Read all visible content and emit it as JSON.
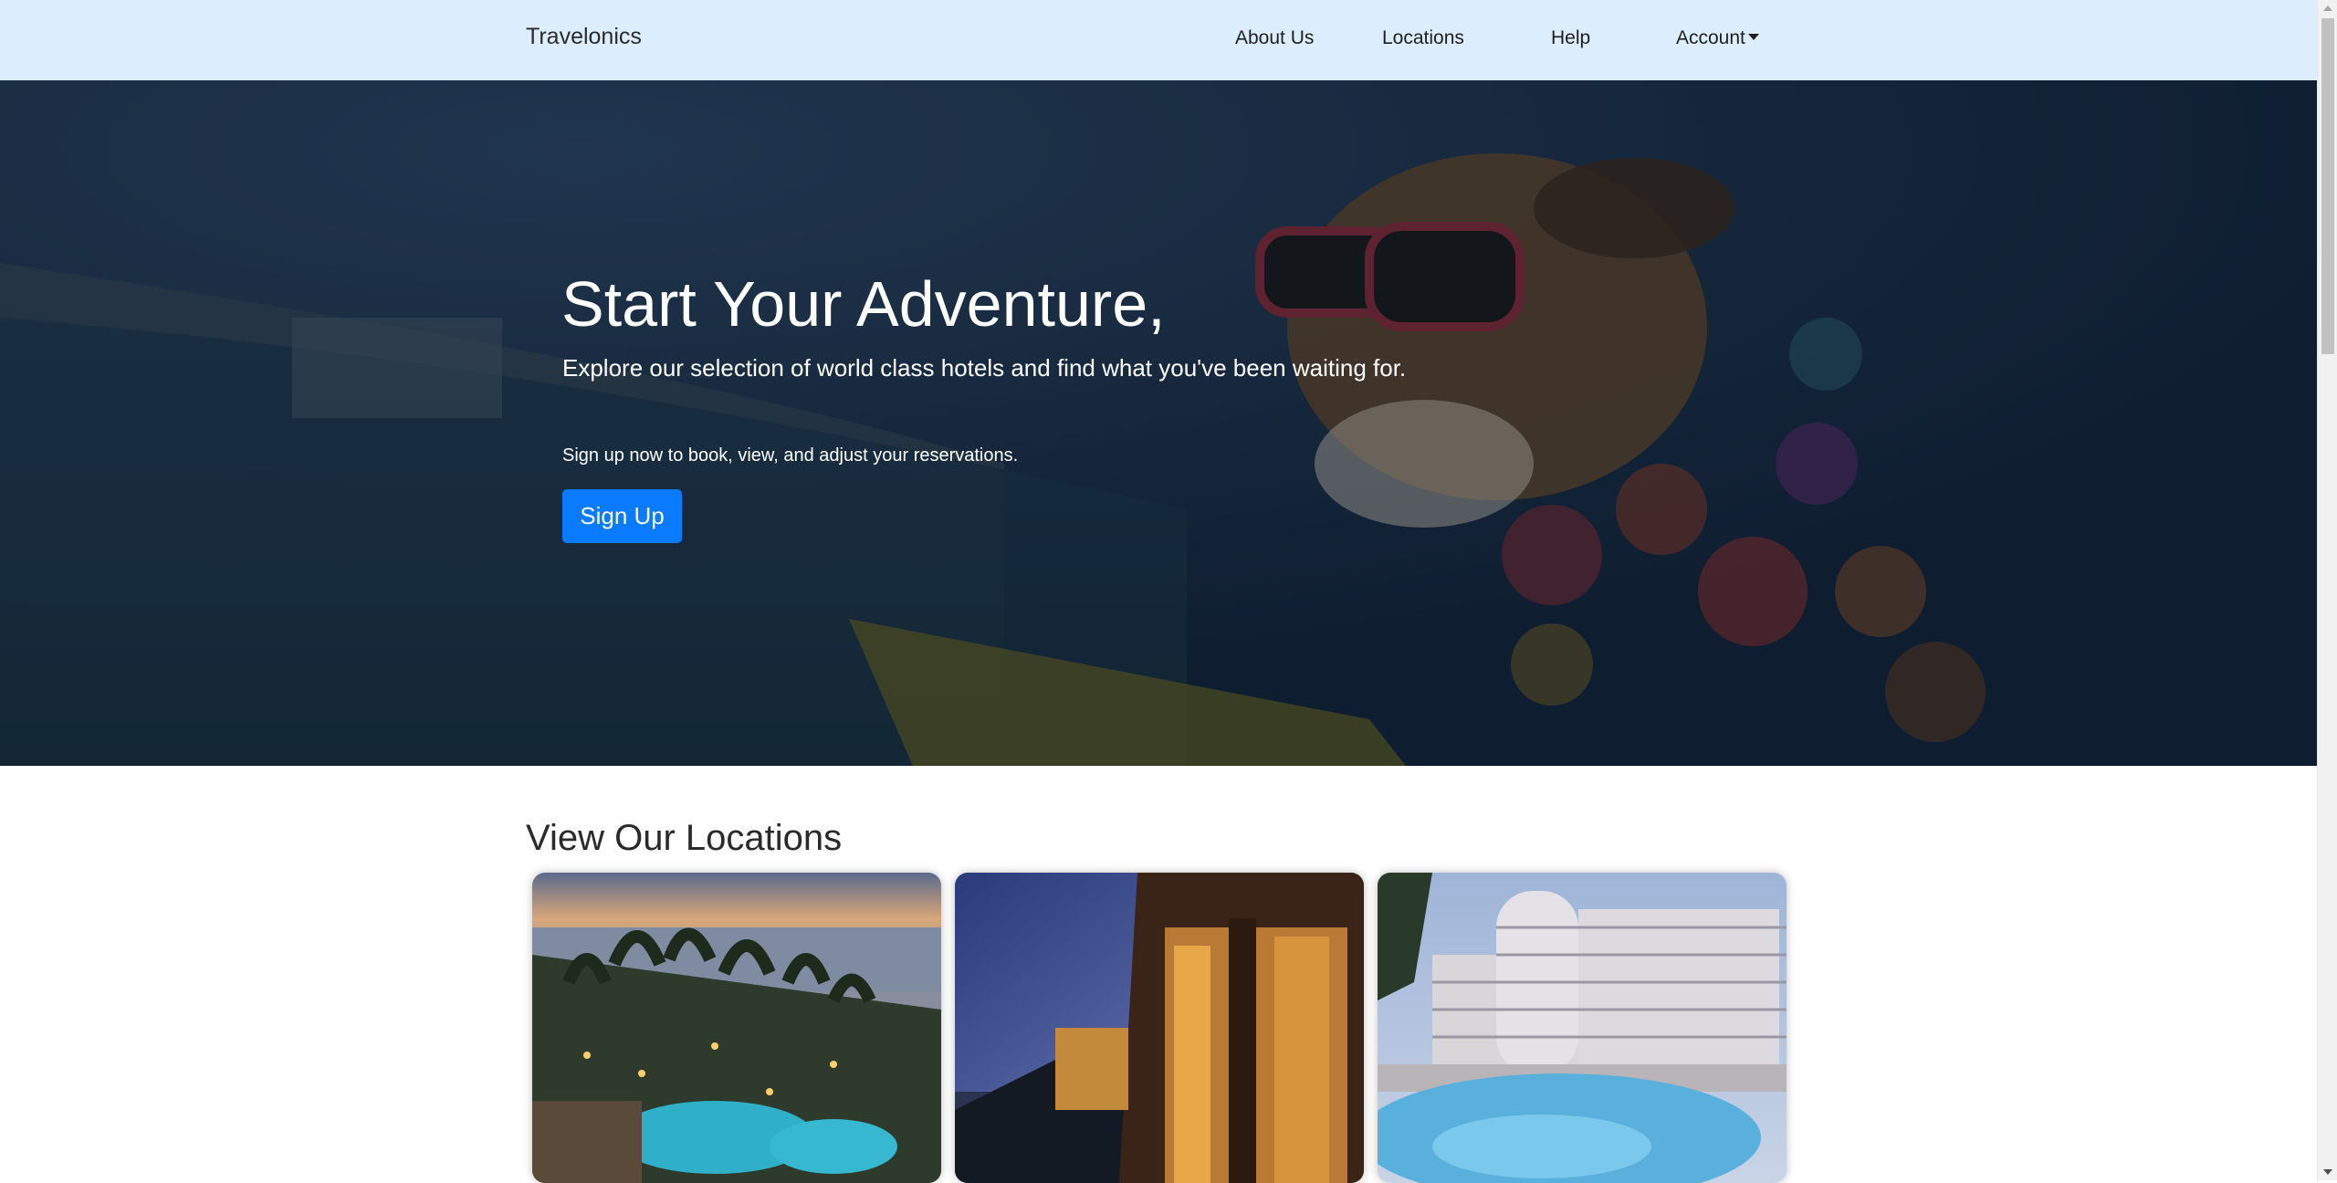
{
  "navbar": {
    "brand": "Travelonics",
    "links": {
      "about": "About Us",
      "locations": "Locations",
      "help": "Help",
      "account": "Account"
    }
  },
  "hero": {
    "title": "Start Your Adventure,",
    "lead": "Explore our selection of world class hotels and find what you've been waiting for.",
    "note": "Sign up now to book, view, and adjust your reservations.",
    "signup_label": "Sign Up"
  },
  "locations": {
    "title": "View Our Locations",
    "cards": [
      {
        "image": "tropical-resort-at-sunset-photo"
      },
      {
        "image": "cliffside-restaurant-at-night-photo"
      },
      {
        "image": "hotel-with-pool-photo"
      }
    ]
  },
  "colors": {
    "navbar_bg": "#dcedfd",
    "primary_button": "#0a7bff",
    "hero_text": "#ffffff"
  },
  "icons": {
    "account_dropdown": "caret-down-icon"
  }
}
